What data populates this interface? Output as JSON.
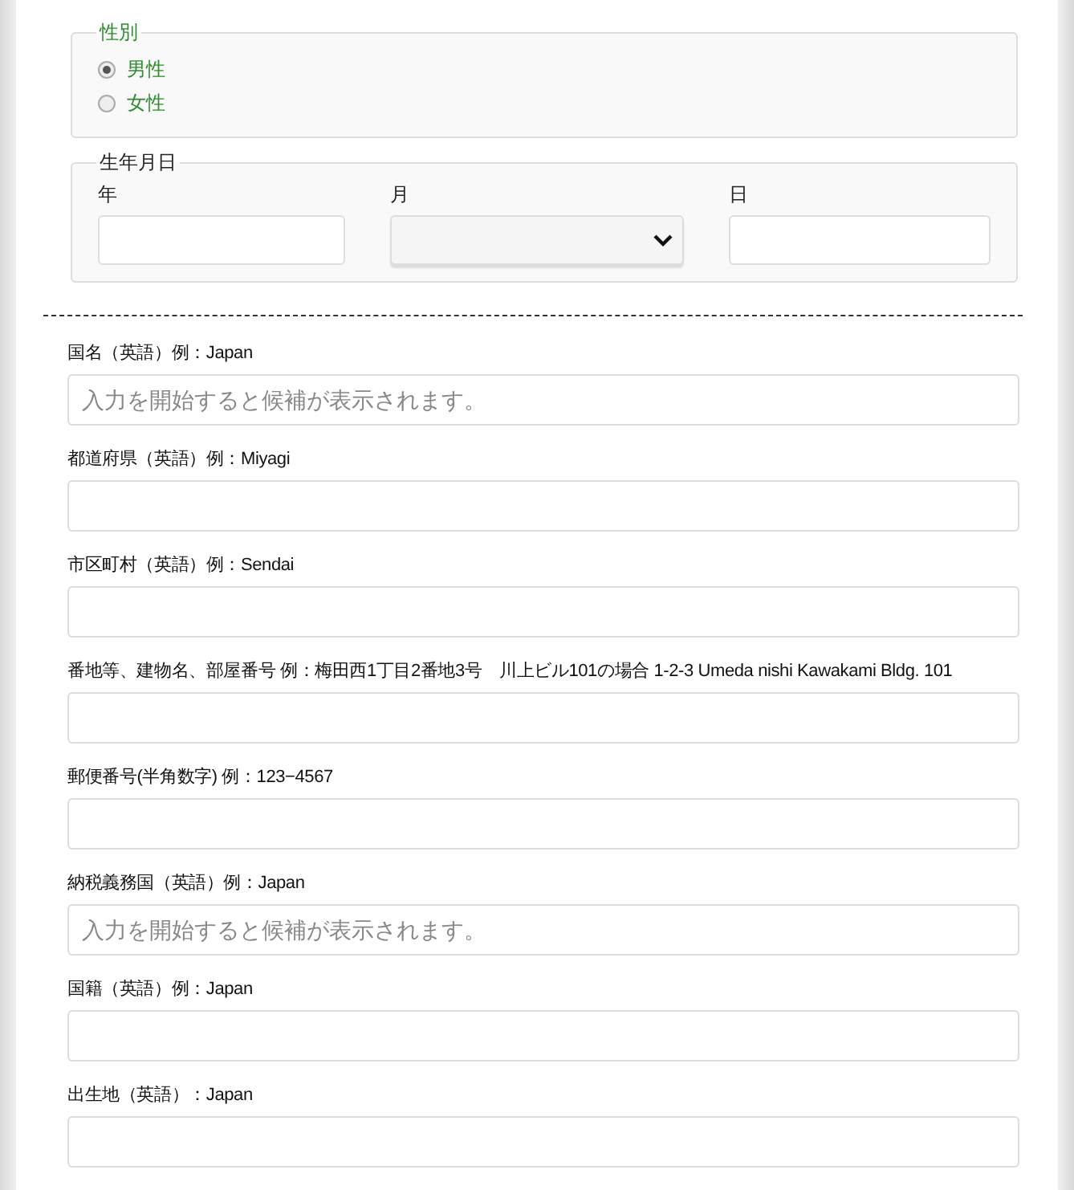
{
  "gender": {
    "legend": "性別",
    "options": [
      {
        "label": "男性",
        "selected": true
      },
      {
        "label": "女性",
        "selected": false
      }
    ]
  },
  "birthdate": {
    "legend": "生年月日",
    "fields": [
      {
        "label": "年",
        "kind": "text"
      },
      {
        "label": "月",
        "kind": "select"
      },
      {
        "label": "日",
        "kind": "text"
      }
    ]
  },
  "fields": [
    {
      "label": "国名（英語）例：Japan",
      "placeholder": "入力を開始すると候補が表示されます。"
    },
    {
      "label": "都道府県（英語）例：Miyagi"
    },
    {
      "label": "市区町村（英語）例：Sendai"
    },
    {
      "label": "番地等、建物名、部屋番号 例：梅田西1丁目2番地3号　川上ビル101の場合 1-2-3 Umeda nishi Kawakami Bldg. 101"
    },
    {
      "label": "郵便番号(半角数字) 例：123−4567"
    },
    {
      "label": "納税義務国（英語）例：Japan",
      "placeholder": "入力を開始すると候補が表示されます。"
    },
    {
      "label": "国籍（英語）例：Japan"
    },
    {
      "label": "出生地（英語）：Japan"
    }
  ]
}
